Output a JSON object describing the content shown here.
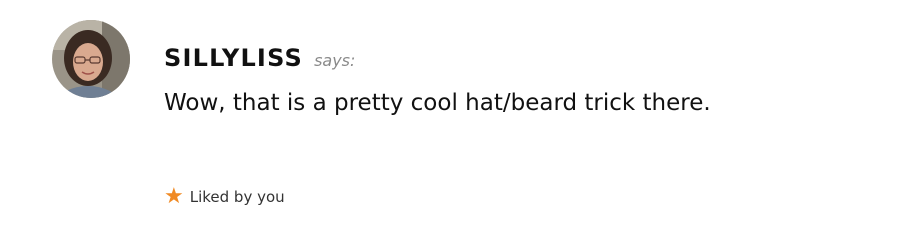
{
  "comment": {
    "author": "SILLYLISS",
    "says": "says:",
    "text": "Wow, that is a pretty cool hat/beard trick there.",
    "likes_text": "Liked by you",
    "avatar_icon": "user-avatar-photo",
    "like_icon": "star-icon"
  },
  "colors": {
    "star": "#f08a24",
    "says": "#8a8a8a",
    "text": "#111111"
  }
}
